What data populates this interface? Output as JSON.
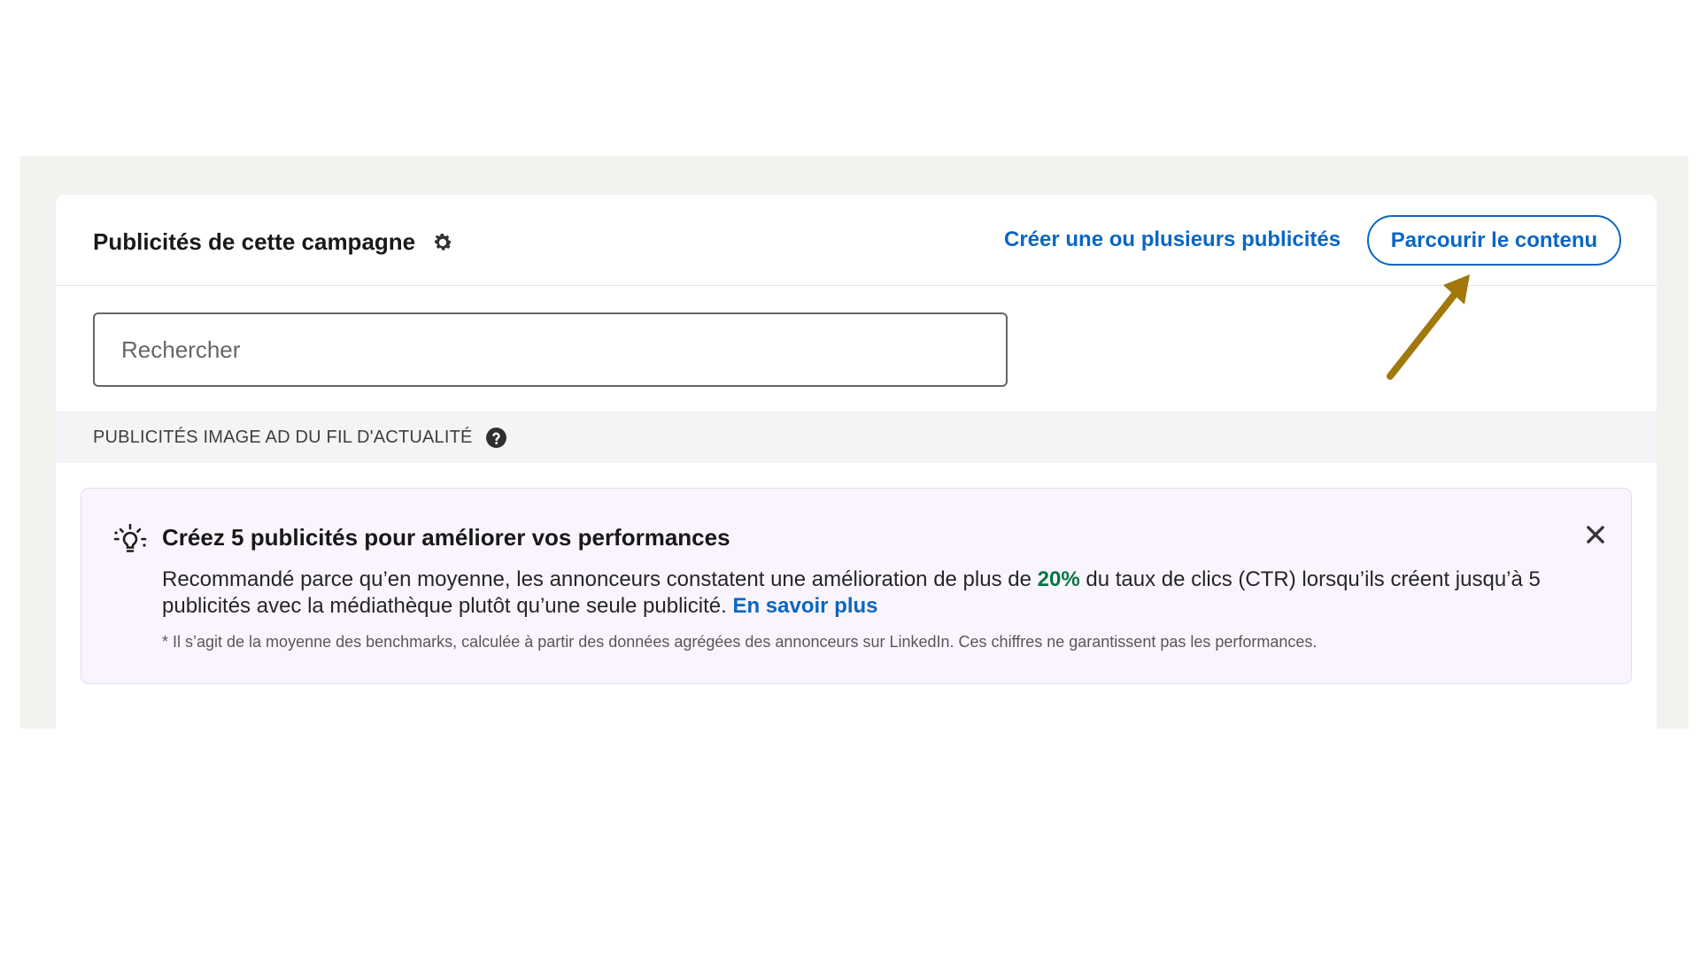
{
  "card": {
    "title": "Publicités de cette campagne",
    "create_link": "Créer une ou plusieurs publicités",
    "browse_button": "Parcourir le contenu"
  },
  "search": {
    "placeholder": "Rechercher"
  },
  "section": {
    "label": "PUBLICITÉS IMAGE AD DU FIL D'ACTUALITÉ"
  },
  "tip": {
    "title": "Créez 5 publicités pour améliorer vos performances",
    "body_before": "Recommandé parce qu’en moyenne, les annonceurs constatent une amélioration de plus de ",
    "highlight": "20%",
    "body_after": " du taux de clics (CTR) lorsqu’ils créent jusqu’à 5 publicités avec la médiathèque plutôt qu’une seule publicité. ",
    "learn_more": "En savoir plus",
    "note": "* Il s’agit de la moyenne des benchmarks, calculée à partir des données agrégées des annonceurs sur LinkedIn. Ces chiffres ne garantissent pas les performances."
  },
  "icons": {
    "gear": "gear-icon",
    "help": "help-icon",
    "bulb": "lightbulb-icon",
    "close": "close-icon",
    "arrow": "arrow-annotation-icon"
  },
  "colors": {
    "brand_blue": "#0a66c2",
    "highlight_green": "#057642",
    "annotation_arrow": "#a0780c",
    "tip_background": "#f9f4fd",
    "outer_background": "#f3f2ef"
  }
}
